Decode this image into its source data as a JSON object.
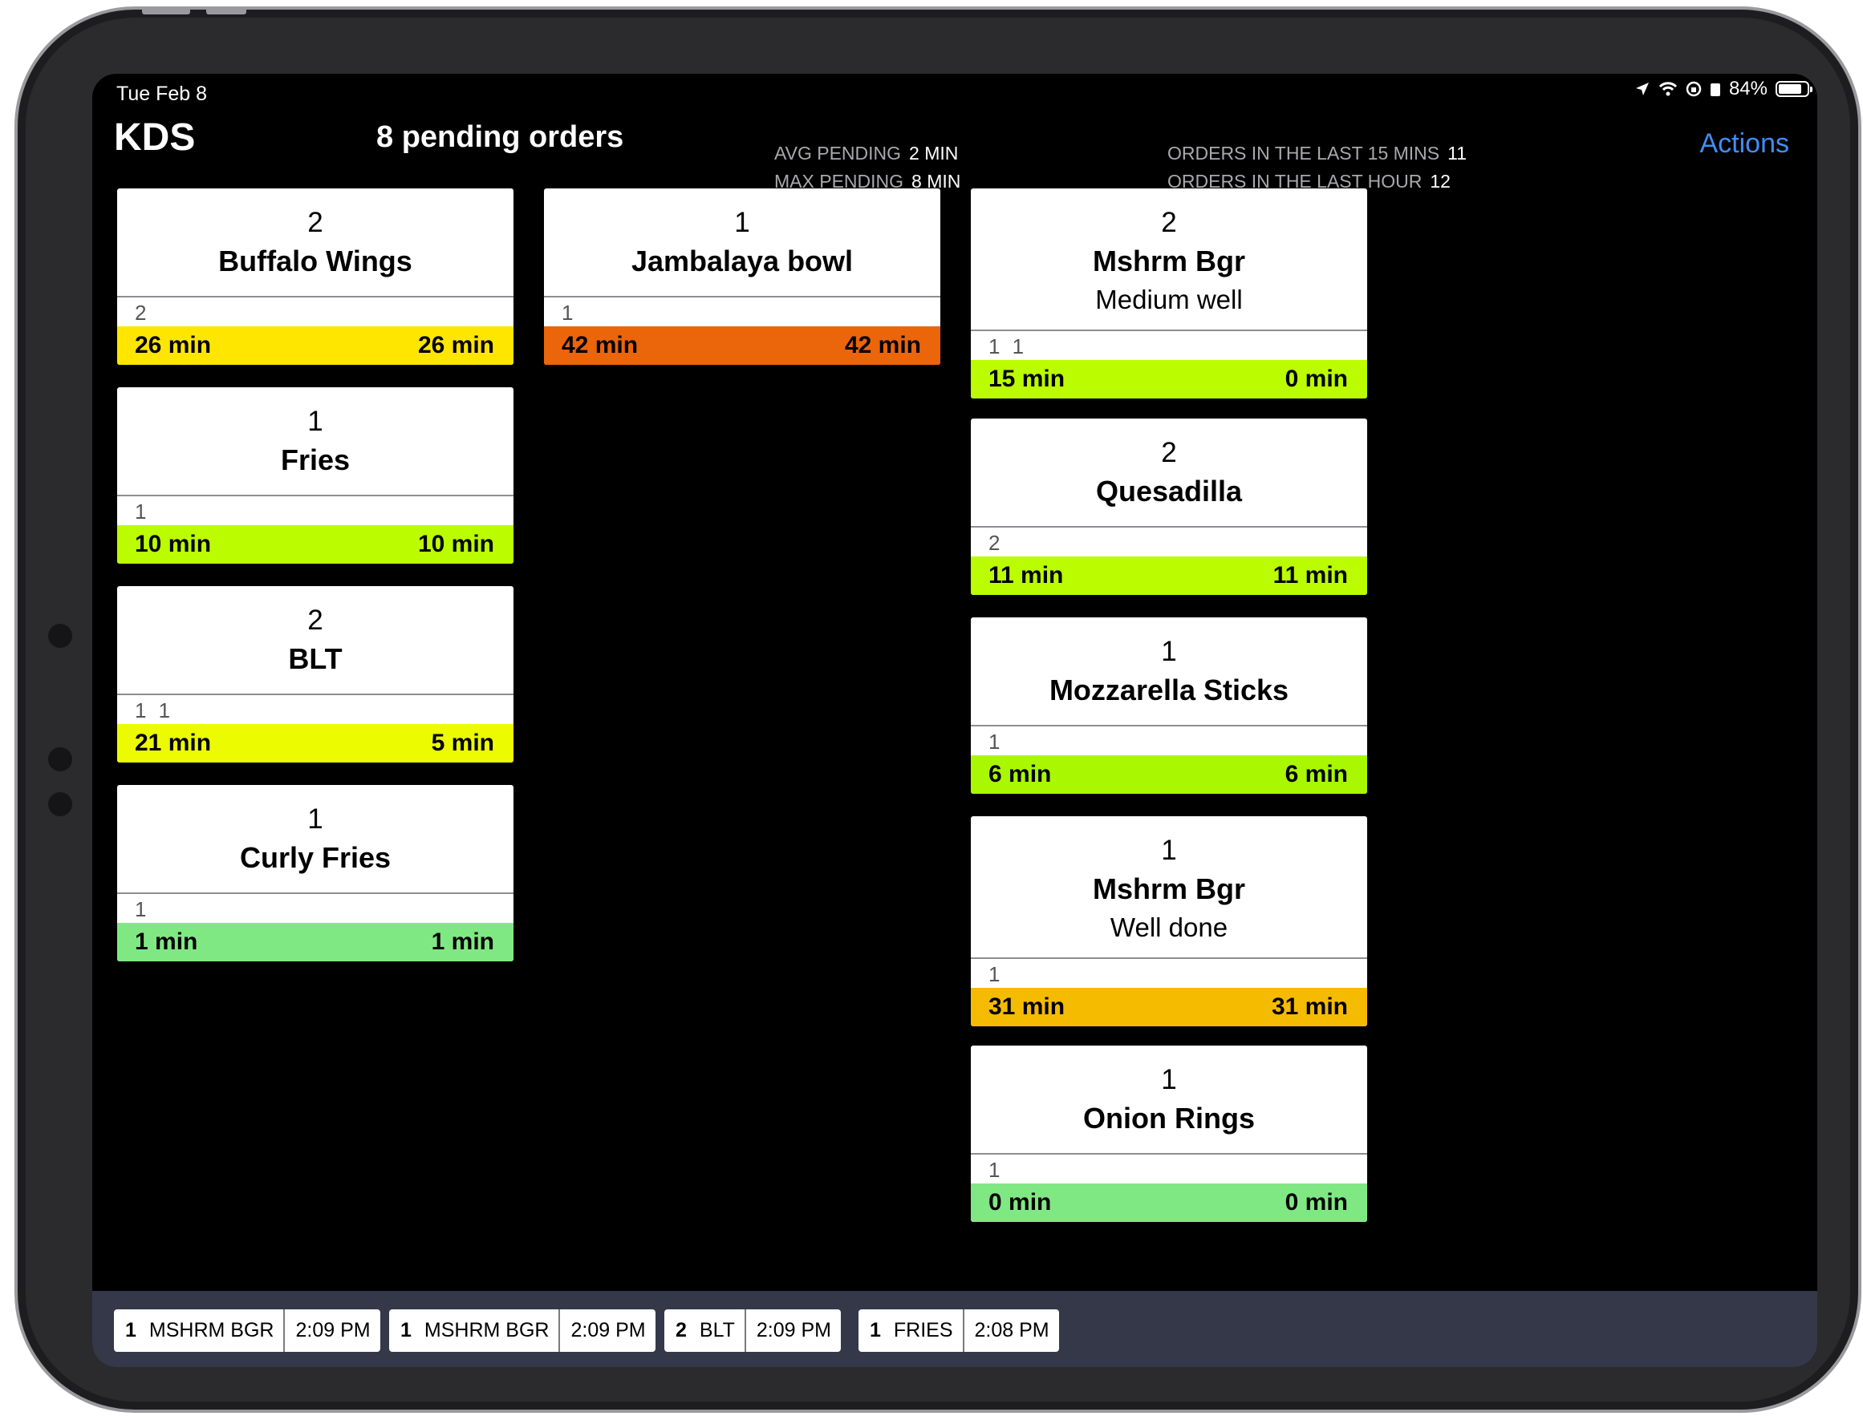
{
  "status_bar": {
    "date": "Tue Feb 8",
    "battery": "84%",
    "battery_level": 0.84
  },
  "header": {
    "title": "KDS",
    "pending": "8 pending orders",
    "avg_pending_label": "AVG PENDING",
    "avg_pending_value": "2 MIN",
    "max_pending_label": "MAX PENDING",
    "max_pending_value": "8 MIN",
    "last15_label": "ORDERS IN THE LAST 15 MINS",
    "last15_value": "11",
    "lasthour_label": "ORDERS IN THE LAST HOUR",
    "lasthour_value": "12",
    "actions": "Actions"
  },
  "colors": {
    "yellow": "#ffe600",
    "lime": "#bbfc00",
    "yellow_lime": "#edfb00",
    "green": "#80e883",
    "orange": "#eb650a",
    "amber": "#f5bb00",
    "accent": "#3f8ef7",
    "strip": "#353849"
  },
  "cards": [
    {
      "qty": "2",
      "name": "Buffalo Wings",
      "modifier": "",
      "seats": "2",
      "elapsed": "26 min",
      "item_time": "26 min",
      "color": "#ffe600"
    },
    {
      "qty": "1",
      "name": "Fries",
      "modifier": "",
      "seats": "1",
      "elapsed": "10 min",
      "item_time": "10 min",
      "color": "#bbfc00"
    },
    {
      "qty": "2",
      "name": "BLT",
      "modifier": "",
      "seats": "1 1",
      "elapsed": "21 min",
      "item_time": "5 min",
      "color": "#edfb00"
    },
    {
      "qty": "1",
      "name": "Curly Fries",
      "modifier": "",
      "seats": "1",
      "elapsed": "1 min",
      "item_time": "1 min",
      "color": "#80e883"
    },
    {
      "qty": "1",
      "name": "Jambalaya bowl",
      "modifier": "",
      "seats": "1",
      "elapsed": "42 min",
      "item_time": "42 min",
      "color": "#eb650a"
    },
    {
      "qty": "2",
      "name": "Mshrm Bgr",
      "modifier": "Medium well",
      "seats": "1 1",
      "elapsed": "15 min",
      "item_time": "0 min",
      "color": "#bbfc00"
    },
    {
      "qty": "2",
      "name": "Quesadilla",
      "modifier": "",
      "seats": "2",
      "elapsed": "11 min",
      "item_time": "11 min",
      "color": "#bbfc00"
    },
    {
      "qty": "1",
      "name": "Mozzarella Sticks",
      "modifier": "",
      "seats": "1",
      "elapsed": "6 min",
      "item_time": "6 min",
      "color": "#a9f700"
    },
    {
      "qty": "1",
      "name": "Mshrm Bgr",
      "modifier": "Well done",
      "seats": "1",
      "elapsed": "31 min",
      "item_time": "31 min",
      "color": "#f5bb00"
    },
    {
      "qty": "1",
      "name": "Onion Rings",
      "modifier": "",
      "seats": "1",
      "elapsed": "0 min",
      "item_time": "0 min",
      "color": "#80e883"
    }
  ],
  "recent": [
    {
      "qty": "1",
      "name": "MSHRM BGR",
      "time": "2:09 PM"
    },
    {
      "qty": "1",
      "name": "MSHRM BGR",
      "time": "2:09 PM"
    },
    {
      "qty": "2",
      "name": "BLT",
      "time": "2:09 PM"
    },
    {
      "qty": "1",
      "name": "FRIES",
      "time": "2:08 PM"
    }
  ]
}
